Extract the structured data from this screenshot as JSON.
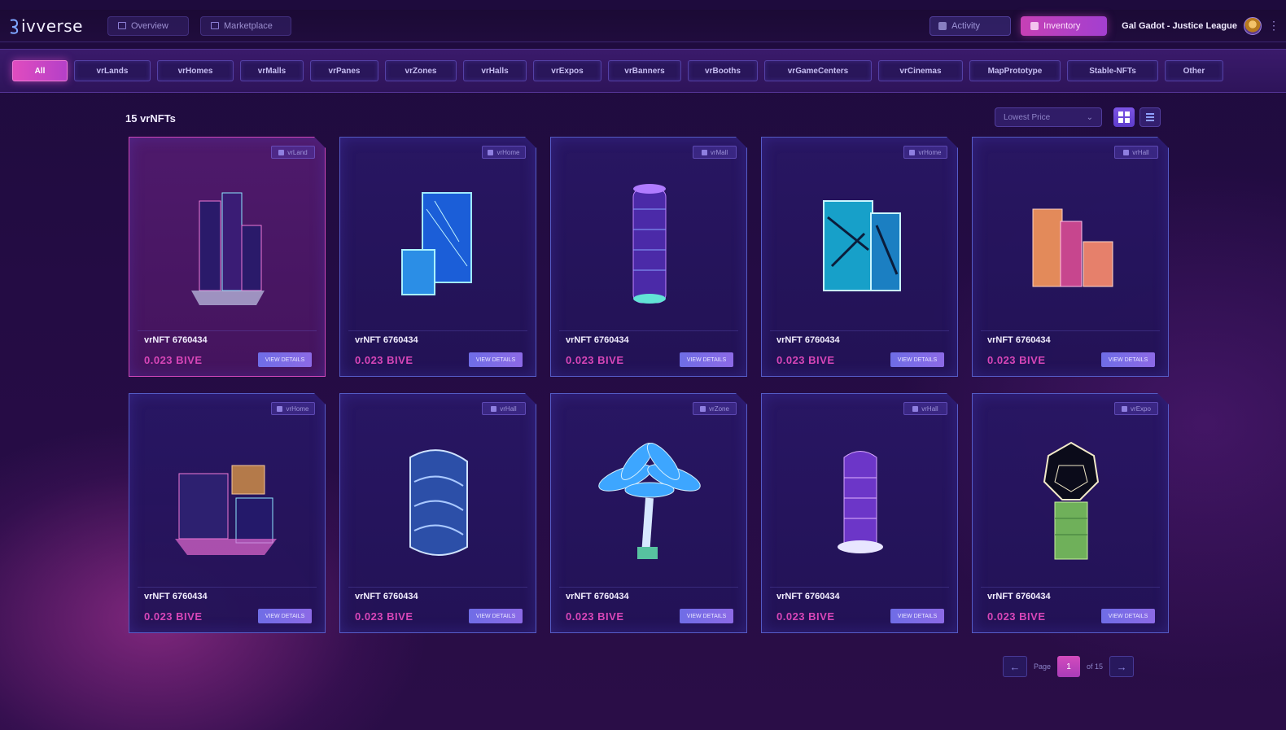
{
  "app": {
    "name": "ivverse"
  },
  "topnav": {
    "overview_label": "Overview",
    "marketplace_label": "Marketplace",
    "activity_label": "Activity",
    "inventory_label": "Inventory",
    "user_name": "Gal Gadot - Justice League"
  },
  "categories": [
    "All",
    "vrLands",
    "vrHomes",
    "vrMalls",
    "vrPanes",
    "vrZones",
    "vrHalls",
    "vrExpos",
    "vrBanners",
    "vrBooths",
    "vrGameCenters",
    "vrCinemas",
    "MapPrototype",
    "Stable-NFTs",
    "Other"
  ],
  "active_category": "All",
  "content": {
    "count_label": "15 vrNFTs",
    "sort_value": "Lowest Price",
    "view_mode": "grid"
  },
  "cards": [
    {
      "title": "vrNFT 6760434",
      "price": "0.023 BIVE",
      "badge": "vrLand",
      "button": "VIEW DETAILS",
      "art": "tower-cluster",
      "selected": true
    },
    {
      "title": "vrNFT 6760434",
      "price": "0.023 BIVE",
      "badge": "vrHome",
      "button": "VIEW DETAILS",
      "art": "glass-blocks",
      "selected": false
    },
    {
      "title": "vrNFT 6760434",
      "price": "0.023 BIVE",
      "badge": "vrMall",
      "button": "VIEW DETAILS",
      "art": "cylinder-tower",
      "selected": false
    },
    {
      "title": "vrNFT 6760434",
      "price": "0.023 BIVE",
      "badge": "vrHome",
      "button": "VIEW DETAILS",
      "art": "crystal-block",
      "selected": false
    },
    {
      "title": "vrNFT 6760434",
      "price": "0.023 BIVE",
      "badge": "vrHall",
      "button": "VIEW DETAILS",
      "art": "orange-blocks",
      "selected": false
    },
    {
      "title": "vrNFT 6760434",
      "price": "0.023 BIVE",
      "badge": "vrHome",
      "button": "VIEW DETAILS",
      "art": "city-block",
      "selected": false
    },
    {
      "title": "vrNFT 6760434",
      "price": "0.023 BIVE",
      "badge": "vrHall",
      "button": "VIEW DETAILS",
      "art": "wave-building",
      "selected": false
    },
    {
      "title": "vrNFT 6760434",
      "price": "0.023 BIVE",
      "badge": "vrZone",
      "button": "VIEW DETAILS",
      "art": "palm-tree",
      "selected": false
    },
    {
      "title": "vrNFT 6760434",
      "price": "0.023 BIVE",
      "badge": "vrHall",
      "button": "VIEW DETAILS",
      "art": "purple-tower",
      "selected": false
    },
    {
      "title": "vrNFT 6760434",
      "price": "0.023 BIVE",
      "badge": "vrExpo",
      "button": "VIEW DETAILS",
      "art": "dome-tower",
      "selected": false
    }
  ],
  "pagination": {
    "page_label": "Page",
    "current": "1",
    "of_label": "of 15",
    "prev": "←",
    "next": "→"
  },
  "colors": {
    "accent": "#d846b8",
    "primary": "#6f6de6",
    "background": "#240c44"
  }
}
